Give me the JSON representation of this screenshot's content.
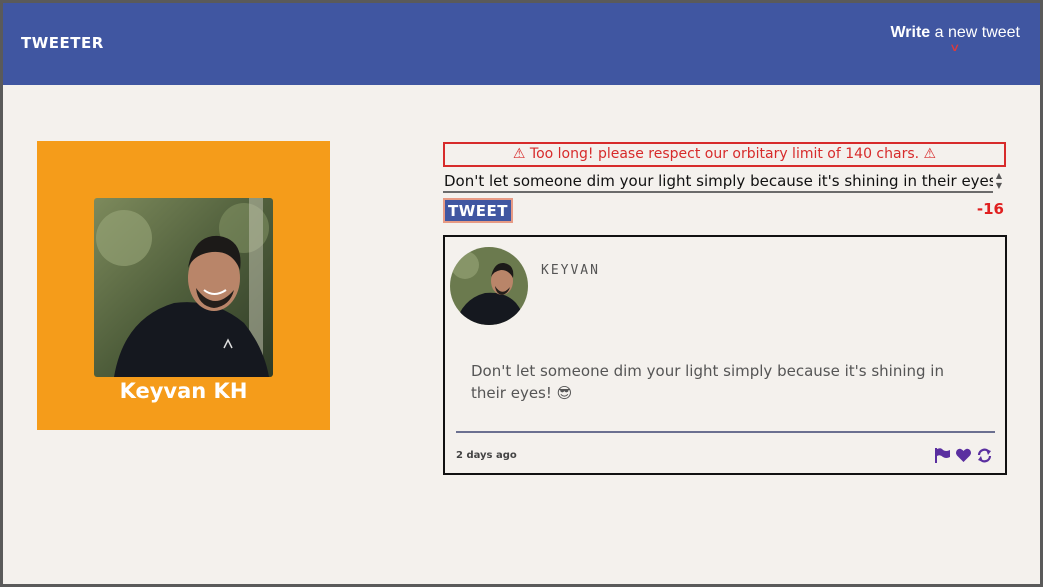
{
  "nav": {
    "brand": "TWEETER",
    "compose_bold": "Write",
    "compose_rest": " a new tweet",
    "compose_icon": "chevron-down-icon"
  },
  "profile": {
    "name": "Keyvan KH",
    "background_color": "#f59c1a"
  },
  "composer": {
    "error": "⚠ Too long! please respect our orbitary limit of 140 chars. ⚠",
    "text": "Don't let someone dim your light simply because it's shining in their eyes! 😎",
    "button": "TWEET",
    "counter": "-16"
  },
  "tweet": {
    "handle": "KEYVAN",
    "content": "Don't let someone dim your light simply because it's shining in their eyes! 😎",
    "time": "2 days ago",
    "actions": [
      "flag-icon",
      "heart-icon",
      "retweet-icon"
    ]
  },
  "colors": {
    "nav": "#4056a1",
    "accent": "#f59c1a",
    "error": "#d72b2b",
    "icon": "#5a2fa0"
  }
}
